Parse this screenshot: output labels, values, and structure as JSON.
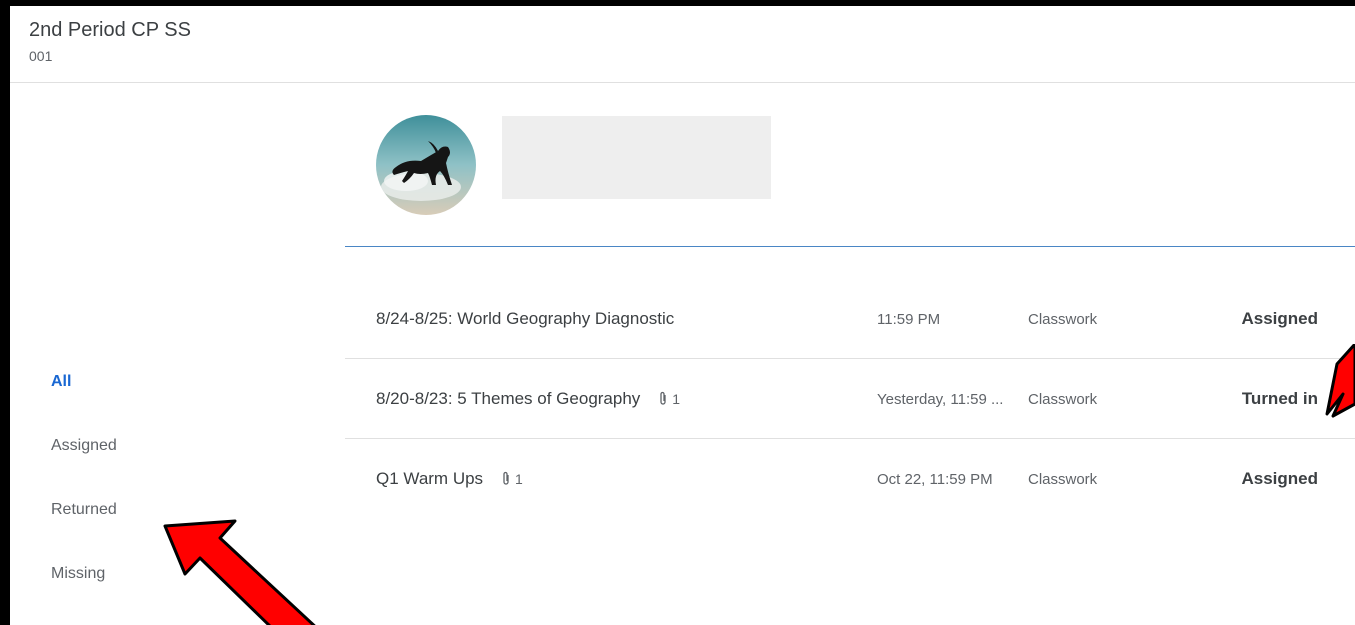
{
  "header": {
    "class_name": "2nd Period CP SS",
    "section": "001"
  },
  "filters": [
    {
      "label": "All",
      "active": true
    },
    {
      "label": "Assigned",
      "active": false
    },
    {
      "label": "Returned",
      "active": false
    },
    {
      "label": "Missing",
      "active": false
    }
  ],
  "student": {
    "avatar_icon": "horse-photo"
  },
  "assignments": [
    {
      "title": "8/24-8/25: World Geography Diagnostic",
      "attachments": "",
      "due": "11:59 PM",
      "topic": "Classwork",
      "status": "Assigned"
    },
    {
      "title": "8/20-8/23: 5 Themes of Geography",
      "attachments": "1",
      "due": "Yesterday, 11:59 ...",
      "topic": "Classwork",
      "status": "Turned in"
    },
    {
      "title": "Q1 Warm Ups",
      "attachments": "1",
      "due": "Oct 22, 11:59 PM",
      "topic": "Classwork",
      "status": "Assigned"
    }
  ],
  "colors": {
    "accent": "#1967d2",
    "divider": "#4a86c5",
    "annotation_arrow": "#ff0000"
  }
}
